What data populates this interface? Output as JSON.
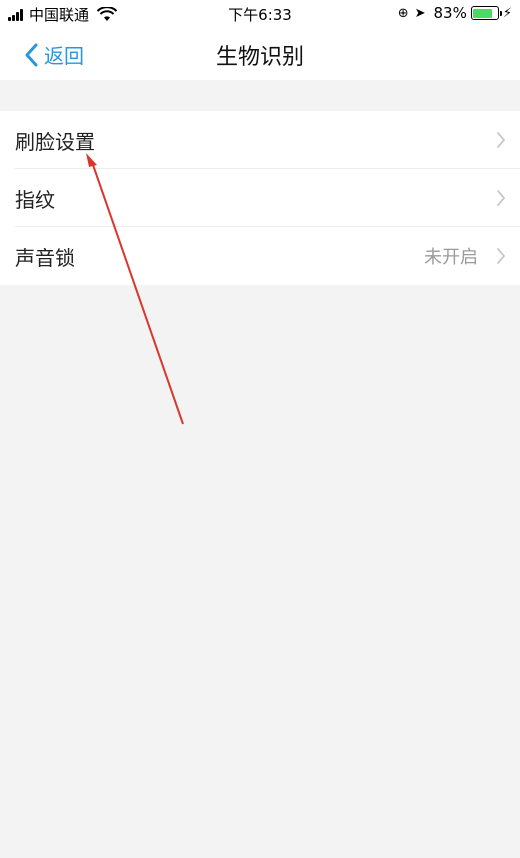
{
  "status_bar": {
    "carrier": "中国联通",
    "time": "下午6:33",
    "battery_percent": "83%",
    "battery_level": 0.83,
    "icons": [
      "signal-icon",
      "wifi-icon",
      "screen-lock-icon",
      "location-icon",
      "battery-icon",
      "charging-icon"
    ]
  },
  "nav": {
    "back_label": "返回",
    "title": "生物识别"
  },
  "list": {
    "items": [
      {
        "label": "刷脸设置",
        "value": ""
      },
      {
        "label": "指纹",
        "value": ""
      },
      {
        "label": "声音锁",
        "value": "未开启"
      }
    ]
  },
  "colors": {
    "accent": "#2a97d9",
    "background": "#f3f3f3",
    "annotation_arrow": "#d9362c",
    "battery": "#4cd964"
  }
}
